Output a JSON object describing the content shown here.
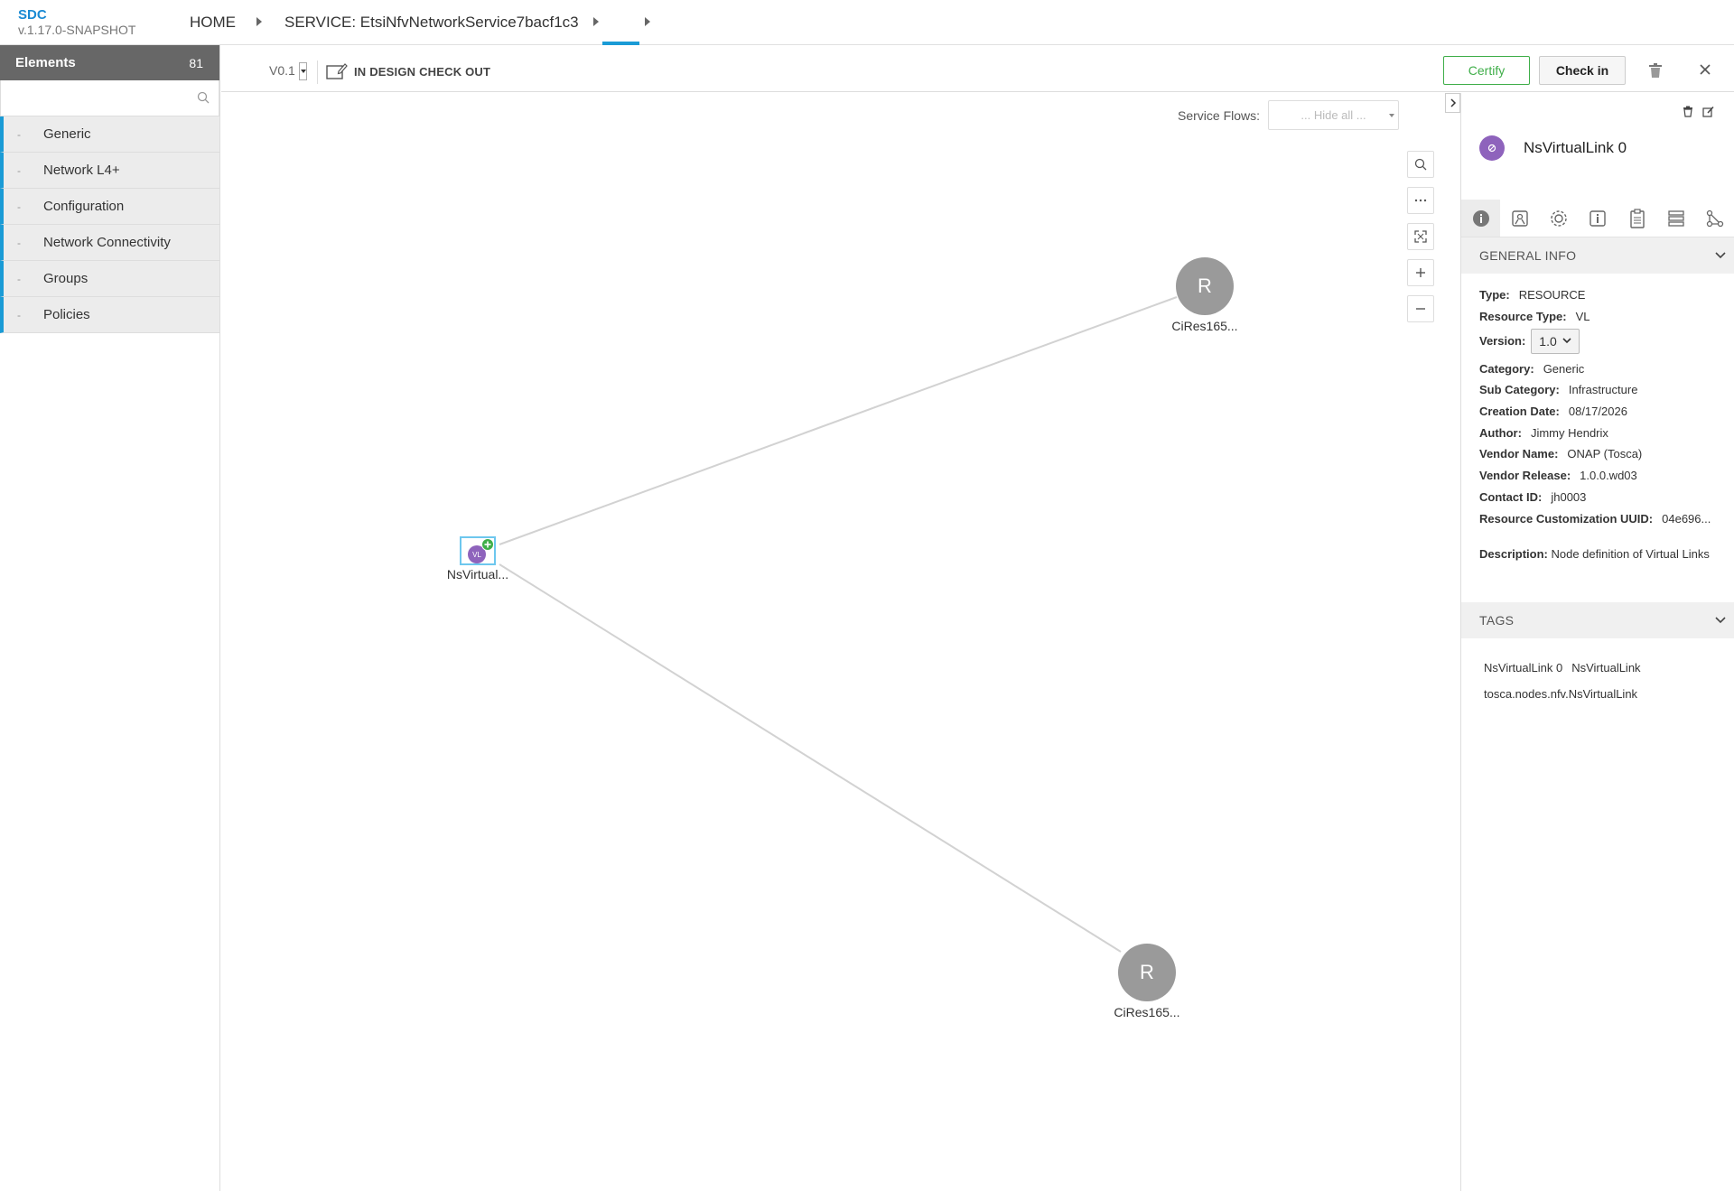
{
  "header": {
    "app_name": "SDC",
    "app_version": "v.1.17.0-SNAPSHOT",
    "breadcrumbs": [
      "HOME",
      "SERVICE: EtsiNfvNetworkService7bacf1c3",
      ""
    ]
  },
  "palette": {
    "title": "Elements",
    "count": "81",
    "search_placeholder": "",
    "categories": [
      "Generic",
      "Network L4+",
      "Configuration",
      "Network Connectivity",
      "Groups",
      "Policies"
    ]
  },
  "toolbar": {
    "version": "V0.1",
    "status": "IN DESIGN CHECK OUT",
    "certify_label": "Certify",
    "checkin_label": "Check in"
  },
  "canvas": {
    "service_flows_label": "Service Flows:",
    "service_flows_value": "... Hide all ...",
    "nodes": [
      {
        "label": "NsVirtual...",
        "icon_text": "VL",
        "type": "virtual-link"
      },
      {
        "label": "CiRes165...",
        "icon_text": "R",
        "type": "resource"
      },
      {
        "label": "CiRes165...",
        "icon_text": "R",
        "type": "resource"
      }
    ]
  },
  "details": {
    "name": "NsVirtualLink 0",
    "general_info_title": "GENERAL INFO",
    "fields": [
      {
        "key": "Type:",
        "value": "RESOURCE"
      },
      {
        "key": "Resource Type:",
        "value": "VL"
      },
      {
        "key": "Version:",
        "value": "1.0"
      },
      {
        "key": "Category:",
        "value": "Generic"
      },
      {
        "key": "Sub Category:",
        "value": "Infrastructure"
      },
      {
        "key": "Creation Date:",
        "value": "08/17/2026"
      },
      {
        "key": "Author:",
        "value": "Jimmy Hendrix"
      },
      {
        "key": "Vendor Name:",
        "value": "ONAP (Tosca)"
      },
      {
        "key": "Vendor Release:",
        "value": "1.0.0.wd03"
      },
      {
        "key": "Contact ID:",
        "value": "jh0003"
      },
      {
        "key": "Resource Customization UUID:",
        "value": "04e696..."
      }
    ],
    "description_key": "Description:",
    "description_value": "Node definition of Virtual Links",
    "tags_title": "TAGS",
    "tags": [
      "NsVirtualLink 0",
      "NsVirtualLink",
      "tosca.nodes.nfv.NsVirtualLink"
    ]
  },
  "colors": {
    "accent": "#1a9bd6",
    "certify": "#3fae49",
    "vl_node": "#8e63bc",
    "resource_node": "#9a9a9a"
  }
}
